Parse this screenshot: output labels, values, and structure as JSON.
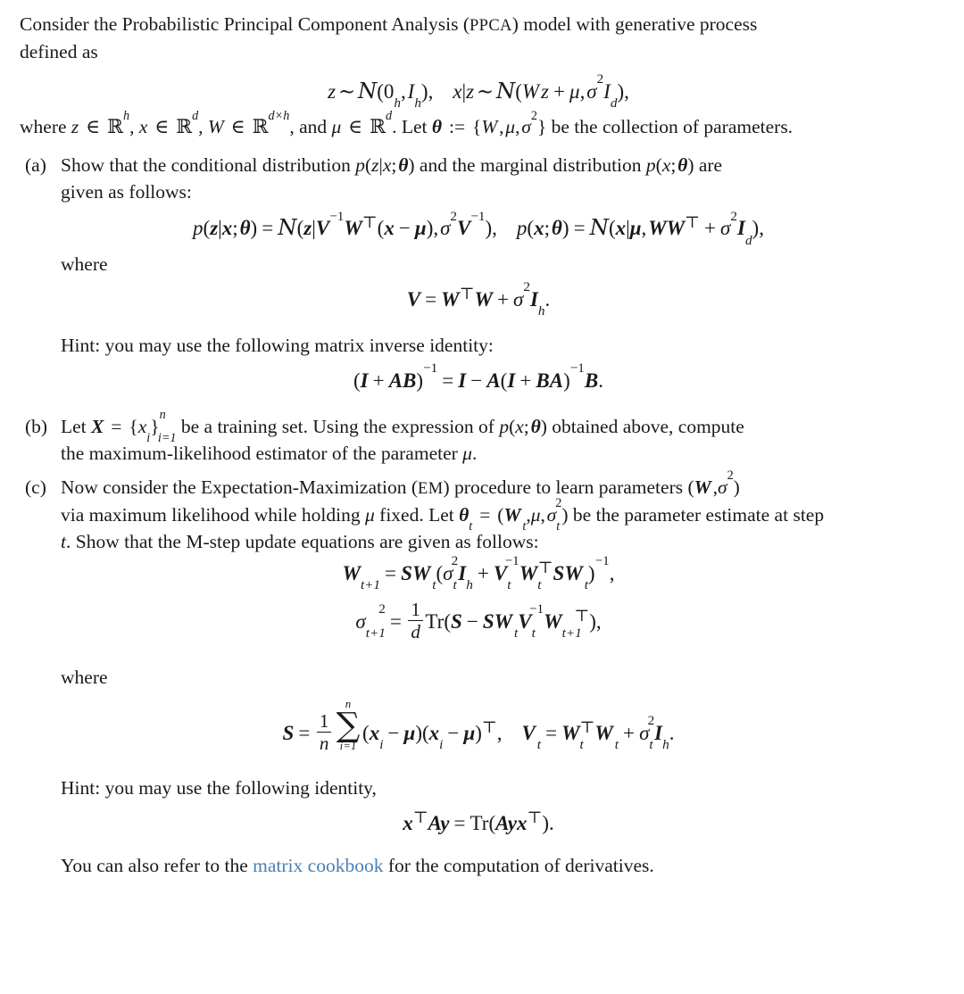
{
  "document": {
    "type": "homework-problem",
    "link_color": "#4a7fb5",
    "text_color": "#1a1a1a",
    "background": "#ffffff"
  },
  "intro": {
    "line1_before_acronym": "Consider the Probabilistic Principal Component Analysis (",
    "acronym": "PPCA",
    "line1_after_acronym": ") model with generative process",
    "line2": "defined as"
  },
  "equations": {
    "generative": "z ~ N(0_h, I_h),    x|z ~ N(Wz + mu, sigma^2 I_d),",
    "posterior_marginal": "p(z|x; theta) = N(z | V^-1 W^T (x - mu), sigma^2 V^-1),    p(x; theta) = N(x | mu, WW^T + sigma^2 I_d),",
    "V_def": "V = W^T W + sigma^2 I_h.",
    "matrix_inverse_identity": "(I + AB)^-1 = I - A(I + BA)^-1 B.",
    "W_update": "W_{t+1} = SW_t(sigma_t^2 I_h + V_t^-1 W_t^T SW_t)^-1,",
    "sigma_update": "sigma_{t+1}^2 = (1/d) Tr(S - SW_t V_t^-1 W_{t+1}^T),",
    "S_def": "S = (1/n) sum_{i=1}^{n} (x_i - mu)(x_i - mu)^T,    V_t = W_t^T W_t + sigma_t^2 I_h.",
    "trace_identity": "x^T A y = Tr(A y x^T)."
  },
  "where_clause": {
    "prefix": "where",
    "full_text": "where z in R^h, x in R^d, W in R^{d x h}, and mu in R^d. Let theta := {W, mu, sigma^2} be the collection of parameters."
  },
  "where_label": "where",
  "items": [
    {
      "label": "(a)",
      "text_line1": "Show that the conditional distribution p(z|x; theta) and the marginal distribution p(x; theta) are",
      "text_line2": "given as follows:",
      "hint": "Hint: you may use the following matrix inverse identity:"
    },
    {
      "label": "(b)",
      "text_line1": "Let X = {x_i}_{i=1}^{n} be a training set. Using the expression of p(x; theta) obtained above, compute",
      "text_line2": "the maximum-likelihood estimator of the parameter mu."
    },
    {
      "label": "(c)",
      "acronym": "EM",
      "text_line1_a": "Now consider the Expectation-Maximization (",
      "text_line1_b": ") procedure to learn parameters (W, sigma^2)",
      "text_line2": "via maximum likelihood while holding mu fixed. Let theta_t = (W_t, mu, sigma_t^2) be the parameter estimate at step",
      "text_line3": "t. Show that the M-step update equations are given as follows:",
      "hint": "Hint: you may use the following identity,"
    }
  ],
  "footer": {
    "before_link": "You can also refer to the ",
    "link_text": "matrix cookbook",
    "after_link": " for the computation of derivatives."
  }
}
